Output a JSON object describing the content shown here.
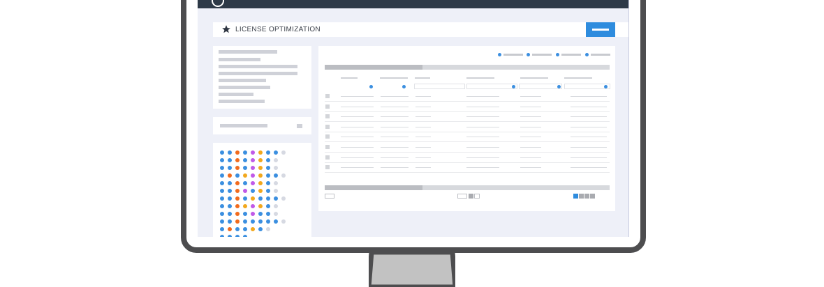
{
  "header": {
    "title": "LICENSE OPTIMIZATION",
    "title_icon": "star-icon"
  },
  "colors": {
    "monitor_frame": "#4d4d4f",
    "app_bar": "#2d3947",
    "screen_bg": "#eef0f8",
    "accent_blue": "#2e8cde",
    "dot_blue": "#3b8fe0",
    "dot_orange": "#f26b1d",
    "dot_purple": "#c05ae8",
    "dot_yellow": "#f2a81d",
    "dot_gray": "#d6d9e2"
  },
  "dot_matrix": {
    "rows": [
      [
        "b",
        "b",
        "o",
        "b",
        "p",
        "y",
        "b",
        "b",
        "g"
      ],
      [
        "b",
        "b",
        "o",
        "b",
        "p",
        "y",
        "b",
        "g"
      ],
      [
        "b",
        "b",
        "o",
        "b",
        "p",
        "y",
        "b",
        "g"
      ],
      [
        "b",
        "o",
        "b",
        "y",
        "p",
        "y",
        "b",
        "b",
        "g"
      ],
      [
        "b",
        "b",
        "o",
        "b",
        "p",
        "y",
        "b",
        "g"
      ],
      [
        "b",
        "b",
        "o",
        "p",
        "b",
        "y",
        "b",
        "g"
      ],
      [
        "b",
        "b",
        "o",
        "b",
        "y",
        "b",
        "b",
        "b",
        "g"
      ],
      [
        "b",
        "b",
        "o",
        "y",
        "p",
        "y",
        "b",
        "g"
      ],
      [
        "b",
        "b",
        "o",
        "b",
        "p",
        "b",
        "b",
        "g"
      ],
      [
        "b",
        "b",
        "o",
        "b",
        "b",
        "b",
        "b",
        "b",
        "g"
      ],
      [
        "b",
        "o",
        "b",
        "b",
        "y",
        "b",
        "g"
      ],
      [
        "b",
        "b",
        "b",
        "b"
      ]
    ]
  },
  "table": {
    "row_count": 8,
    "pagination_pages": 4,
    "active_page": 1
  }
}
